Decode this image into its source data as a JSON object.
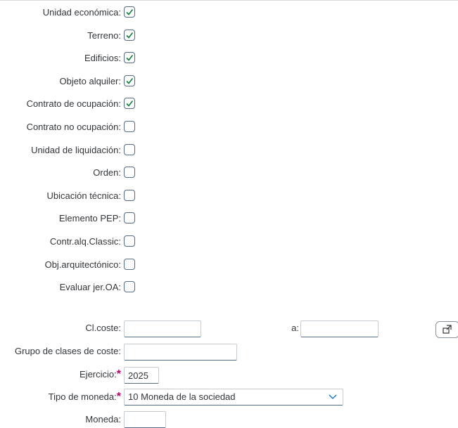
{
  "checkboxes": [
    {
      "label": "Unidad económica:",
      "checked": true
    },
    {
      "label": "Terreno:",
      "checked": true
    },
    {
      "label": "Edificios:",
      "checked": true
    },
    {
      "label": "Objeto alquiler:",
      "checked": true
    },
    {
      "label": "Contrato de ocupación:",
      "checked": true
    },
    {
      "label": "Contrato no ocupación:",
      "checked": false
    },
    {
      "label": "Unidad de liquidación:",
      "checked": false
    },
    {
      "label": "Orden:",
      "checked": false
    },
    {
      "label": "Ubicación técnica:",
      "checked": false
    },
    {
      "label": "Elemento PEP:",
      "checked": false
    },
    {
      "label": "Contr.alq.Classic:",
      "checked": false
    },
    {
      "label": "Obj.arquitectónico:",
      "checked": false
    },
    {
      "label": "Evaluar jer.OA:",
      "checked": false
    }
  ],
  "form": {
    "clcoste_label": "Cl.coste:",
    "clcoste_from_value": "",
    "clcoste_to_label": "a:",
    "clcoste_to_value": "",
    "grupo_label": "Grupo de clases de coste:",
    "grupo_value": "",
    "ejercicio_label": "Ejercicio:",
    "ejercicio_value": "2025",
    "tipo_moneda_label": "Tipo de moneda:",
    "tipo_moneda_value": "10 Moneda de la sociedad",
    "moneda_label": "Moneda:",
    "moneda_value": "",
    "required_mark": "*"
  },
  "colors": {
    "check": "#107e3e",
    "required": "#bb0066",
    "field_border": "#556b82"
  },
  "icons": {
    "multiple_selection": "external-link-icon",
    "dropdown": "chevron-down-icon"
  }
}
